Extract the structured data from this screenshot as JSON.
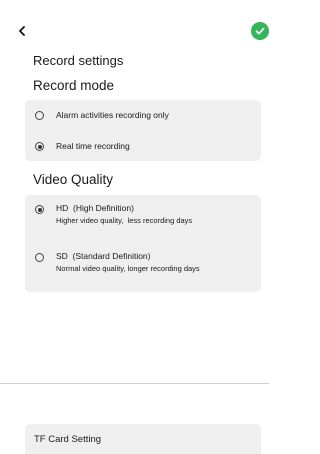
{
  "header": {
    "back_icon": "chevron-left-icon",
    "confirm_icon": "check-circle-icon",
    "accent_color": "#34b55a"
  },
  "page": {
    "title": "Record settings"
  },
  "record_mode": {
    "title": "Record mode",
    "options": [
      {
        "label": "Alarm activities recording only",
        "selected": false
      },
      {
        "label": "Real time recording",
        "selected": true
      }
    ]
  },
  "video_quality": {
    "title": "Video Quality",
    "options": [
      {
        "label": "HD  (High Definition)",
        "description": "Higher video quality,  less recording days",
        "selected": true
      },
      {
        "label": "SD  (Standard Definition)",
        "description": "Normal video quality, longer recording days",
        "selected": false
      }
    ]
  },
  "tf_card": {
    "label": "TF Card Setting"
  }
}
